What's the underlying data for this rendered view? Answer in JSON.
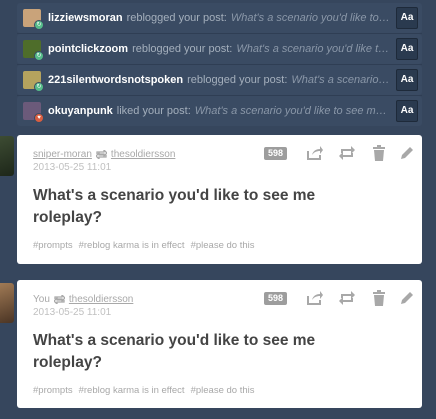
{
  "notifications": [
    {
      "user": "lizziewsmoran",
      "action": "reblogged your post:",
      "post": "What's a scenario you'd like to see me roleplay?",
      "type": "reblog",
      "avatar_color": "#c9a37a",
      "button": "Aa"
    },
    {
      "user": "pointclickzoom",
      "action": "reblogged your post:",
      "post": "What's a scenario you'd like to see me roleplay?",
      "type": "reblog",
      "avatar_color": "#4e6d2a",
      "button": "Aa"
    },
    {
      "user": "221silentwordsnotspoken",
      "action": "reblogged your post:",
      "post": "What's a scenario you'd like to see me roleplay?",
      "type": "reblog",
      "avatar_color": "#b5a35e",
      "button": "Aa"
    },
    {
      "user": "okuyanpunk",
      "action": "liked your post:",
      "post": "What's a scenario you'd like to see me roleplay?",
      "type": "like",
      "avatar_color": "#6b5a7a",
      "button": "Aa"
    }
  ],
  "posts": [
    {
      "author": "sniper-moran",
      "reblogged_from": "thesoldiersson",
      "date": "2013-05-25 11:01",
      "notes": "598",
      "title": "What's a scenario you'd like to see me roleplay?",
      "tags": [
        "#prompts",
        "#reblog karma is in effect",
        "#please do this"
      ],
      "avatar_color": "#2c3a28"
    },
    {
      "author": "You",
      "reblogged_from": "thesoldiersson",
      "date": "2013-05-25 11:01",
      "notes": "598",
      "title": "What's a scenario you'd like to see me roleplay?",
      "tags": [
        "#prompts",
        "#reblog karma is in effect",
        "#please do this"
      ],
      "avatar_color": "#7a5a40"
    }
  ],
  "icons": {
    "share": "share-icon",
    "reblog": "reblog-icon",
    "delete": "trash-icon",
    "edit": "pencil-icon",
    "reblog_small": "reblog-small-icon"
  }
}
